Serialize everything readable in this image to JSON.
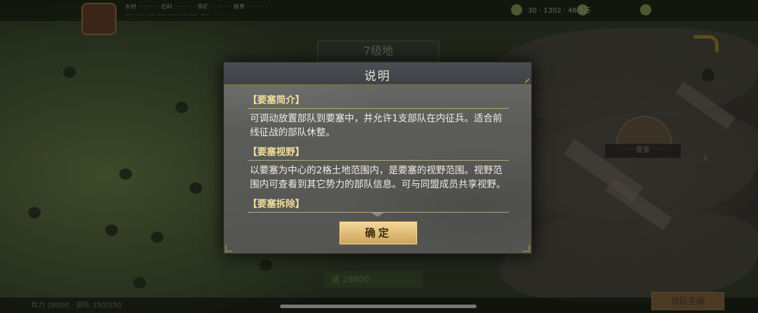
{
  "dialog": {
    "title": "说明",
    "sections": [
      {
        "heading": "【要塞简介】",
        "body": "可调动放置部队到要塞中，并允许1支部队在内征兵。适合前线征战的部队休整。"
      },
      {
        "heading": "【要塞视野】",
        "body": "以要塞为中心的2格土地范围内，是要塞的视野范围。视野范围内可查看到其它势力的部队信息。可与同盟成员共享视野。"
      },
      {
        "heading": "【要塞拆除】",
        "body": ""
      }
    ],
    "confirm_label": "确定"
  },
  "map": {
    "place_banner": "7级地",
    "fortress_label": "要塞",
    "center_unit": "诸 28800",
    "bottom_left": "兵力 28800  ·  部队 250/250",
    "bottom_button": "部队主编",
    "top_resource_1": "木材 ··· ·· ··· ·  石料 ··· ·· ··· ·  铁矿 ··· ·· ··· ·  粮草 ··· ·· ··· ·",
    "top_resource_2": "····· ····· ····· ·····  ····· ·····  ····· ·····",
    "top_right": "30   ·   1302   ·   46.5万"
  },
  "colors": {
    "dialog_bg": "#5b5c5a",
    "title_bar": "#3e4246",
    "section_heading": "#f2dd9a",
    "confirm_button": "#e2c07a"
  }
}
